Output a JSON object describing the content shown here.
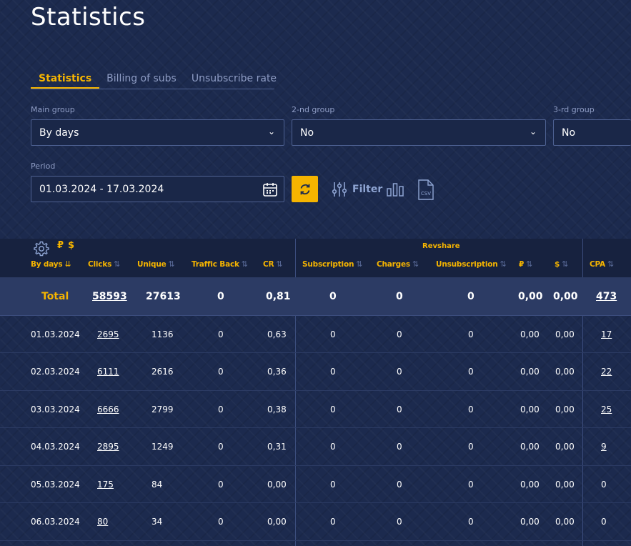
{
  "page_title": "Statistics",
  "tabs": [
    {
      "label": "Statistics",
      "active": true
    },
    {
      "label": "Billing of subs",
      "active": false
    },
    {
      "label": "Unsubscribe rate",
      "active": false
    }
  ],
  "filters": {
    "main_group": {
      "label": "Main group",
      "value": "By days"
    },
    "second_group": {
      "label": "2-nd group",
      "value": "No"
    },
    "third_group": {
      "label": "3-rd group",
      "value": "No"
    },
    "period": {
      "label": "Period",
      "value": "01.03.2024 - 17.03.2024"
    }
  },
  "toolbar": {
    "filter_label": "Filter",
    "csv_label": "CSV"
  },
  "currency": {
    "rub": "₽",
    "usd": "$"
  },
  "table": {
    "group_header": "Revshare",
    "columns": {
      "date": "By days",
      "clicks": "Clicks",
      "unique": "Unique",
      "traffic_back": "Traffic Back",
      "cr": "CR",
      "subscription": "Subscription",
      "charges": "Charges",
      "unsubscription": "Unsubscription",
      "rub": "₽",
      "usd": "$",
      "cpa": "CPA"
    },
    "total": {
      "label": "Total",
      "clicks": "58593",
      "unique": "27613",
      "traffic_back": "0",
      "cr": "0,81",
      "subscription": "0",
      "charges": "0",
      "unsubscription": "0",
      "rub": "0,00",
      "usd": "0,00",
      "cpa": "473"
    },
    "rows": [
      {
        "date": "01.03.2024",
        "clicks": "2695",
        "unique": "1136",
        "traffic_back": "0",
        "cr": "0,63",
        "subscription": "0",
        "charges": "0",
        "unsubscription": "0",
        "rub": "0,00",
        "usd": "0,00",
        "cpa": "17"
      },
      {
        "date": "02.03.2024",
        "clicks": "6111",
        "unique": "2616",
        "traffic_back": "0",
        "cr": "0,36",
        "subscription": "0",
        "charges": "0",
        "unsubscription": "0",
        "rub": "0,00",
        "usd": "0,00",
        "cpa": "22"
      },
      {
        "date": "03.03.2024",
        "clicks": "6666",
        "unique": "2799",
        "traffic_back": "0",
        "cr": "0,38",
        "subscription": "0",
        "charges": "0",
        "unsubscription": "0",
        "rub": "0,00",
        "usd": "0,00",
        "cpa": "25"
      },
      {
        "date": "04.03.2024",
        "clicks": "2895",
        "unique": "1249",
        "traffic_back": "0",
        "cr": "0,31",
        "subscription": "0",
        "charges": "0",
        "unsubscription": "0",
        "rub": "0,00",
        "usd": "0,00",
        "cpa": "9"
      },
      {
        "date": "05.03.2024",
        "clicks": "175",
        "unique": "84",
        "traffic_back": "0",
        "cr": "0,00",
        "subscription": "0",
        "charges": "0",
        "unsubscription": "0",
        "rub": "0,00",
        "usd": "0,00",
        "cpa": "0"
      },
      {
        "date": "06.03.2024",
        "clicks": "80",
        "unique": "34",
        "traffic_back": "0",
        "cr": "0,00",
        "subscription": "0",
        "charges": "0",
        "unsubscription": "0",
        "rub": "0,00",
        "usd": "0,00",
        "cpa": "0"
      }
    ]
  },
  "colors": {
    "accent": "#f5b400",
    "background": "#1c2a4e"
  }
}
